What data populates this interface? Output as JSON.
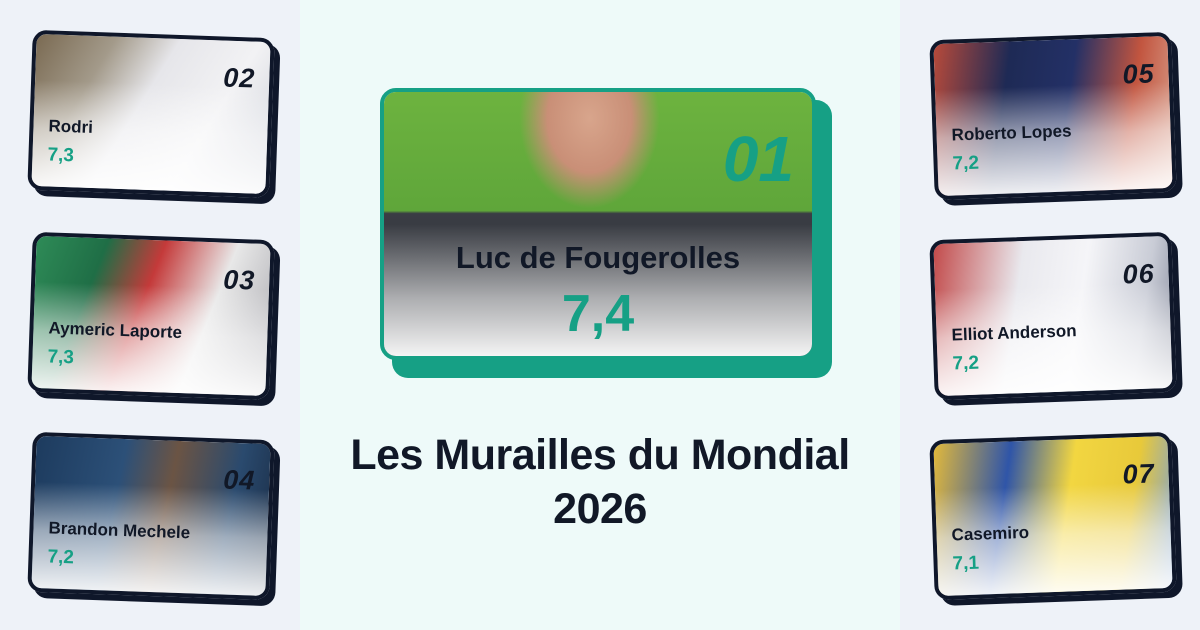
{
  "title_line1": "Les Murailles du Mondial",
  "title_line2": "2026",
  "colors": {
    "accent": "#16a085",
    "ink": "#111827",
    "background": "#eef2f8",
    "panel": "#eefaf9"
  },
  "featured": {
    "rank": "01",
    "name": "Luc de Fougerolles",
    "score": "7,4"
  },
  "players": [
    {
      "rank": "02",
      "name": "Rodri",
      "score": "7,3"
    },
    {
      "rank": "03",
      "name": "Aymeric Laporte",
      "score": "7,3"
    },
    {
      "rank": "04",
      "name": "Brandon Mechele",
      "score": "7,2"
    },
    {
      "rank": "05",
      "name": "Roberto Lopes",
      "score": "7,2"
    },
    {
      "rank": "06",
      "name": "Elliot Anderson",
      "score": "7,2"
    },
    {
      "rank": "07",
      "name": "Casemiro",
      "score": "7,1"
    }
  ]
}
